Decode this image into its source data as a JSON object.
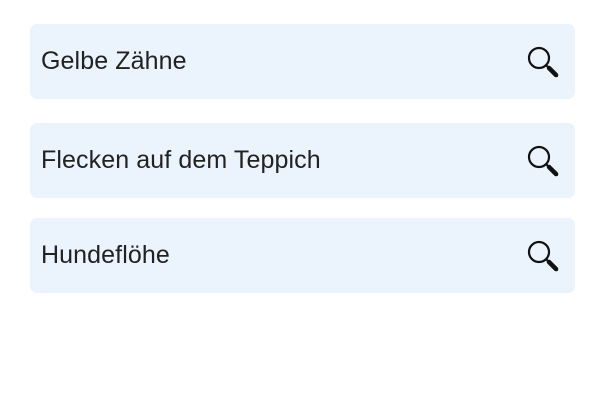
{
  "suggestions": [
    {
      "label": "Gelbe Zähne",
      "icon": "search-icon"
    },
    {
      "label": "Flecken auf dem Teppich",
      "icon": "search-icon"
    },
    {
      "label": "Hundeflöhe",
      "icon": "search-icon"
    }
  ],
  "colors": {
    "card_background": "#ebf3fd",
    "text": "#222222",
    "icon": "#111111"
  }
}
